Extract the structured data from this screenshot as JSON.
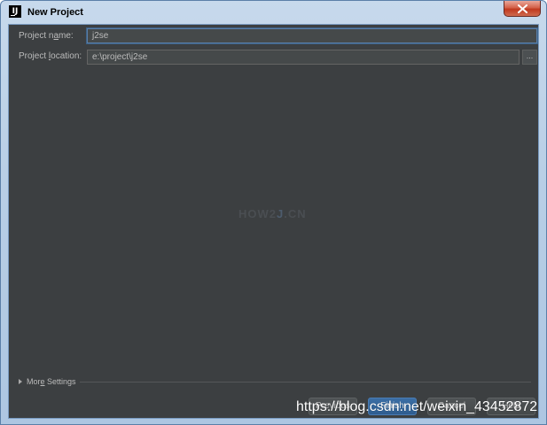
{
  "window": {
    "title": "New Project"
  },
  "form": {
    "project_name": {
      "label_before": "Project n",
      "label_mnemonic": "a",
      "label_after": "me:",
      "value": "j2se"
    },
    "project_location": {
      "label_before": "Project ",
      "label_mnemonic": "l",
      "label_after": "ocation:",
      "value": "e:\\project\\j2se"
    },
    "browse_label": "..."
  },
  "watermark_center": {
    "part1": "HOW2",
    "part2": "J",
    "part3": ".CN"
  },
  "more_settings": {
    "label_before": "Mor",
    "label_mnemonic": "e",
    "label_after": " Settings"
  },
  "buttons": {
    "previous": "Previous",
    "finish": "Finish",
    "cancel": "Cancel",
    "help": "Help"
  },
  "overlay_watermark": "https://blog.csdn.net/weixin_43452872",
  "colors": {
    "dialog_background": "#3c3f41",
    "input_background": "#45494a",
    "focus_border": "#5a7fa9",
    "text": "#bbbbbb",
    "primary_button": "#365880"
  },
  "icons": {
    "app": "intellij-idea-icon",
    "close": "close-icon",
    "more_settings": "triangle-right-icon"
  }
}
